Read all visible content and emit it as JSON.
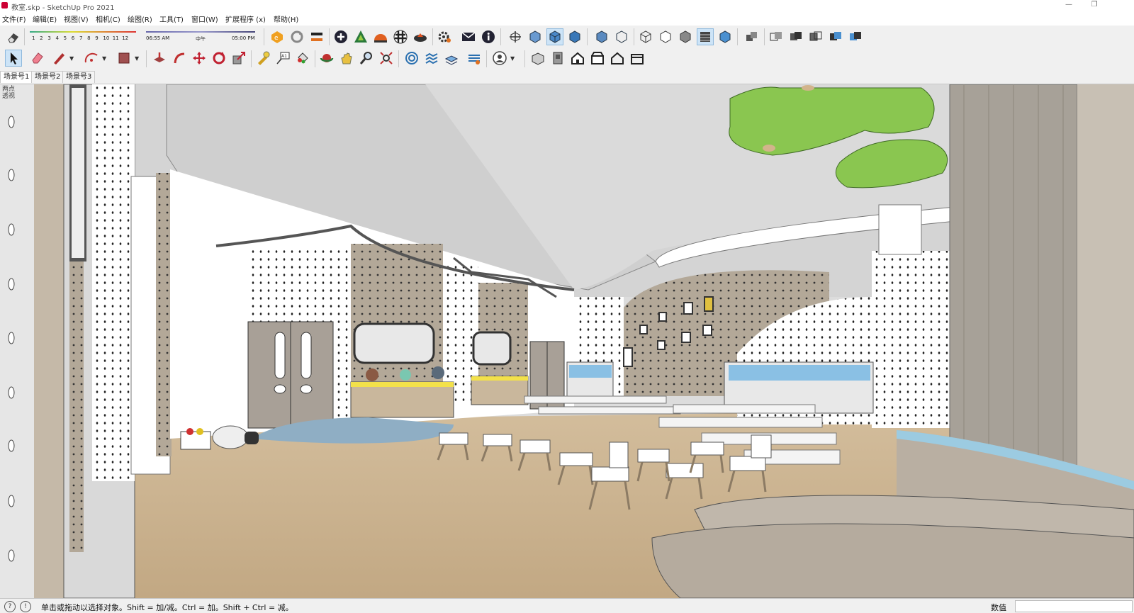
{
  "window": {
    "title": "教室.skp - SketchUp Pro 2021",
    "minimize": "—",
    "restore": "❐",
    "close": ""
  },
  "menu": [
    "文件(F)",
    "编辑(E)",
    "视图(V)",
    "相机(C)",
    "绘图(R)",
    "工具(T)",
    "窗口(W)",
    "扩展程序 (x)",
    "帮助(H)"
  ],
  "shadow": {
    "months": [
      "1",
      "2",
      "3",
      "4",
      "5",
      "6",
      "7",
      "8",
      "9",
      "10",
      "11",
      "12"
    ],
    "time_start": "06:55 AM",
    "time_mid": "中午",
    "time_end": "05:00 PM"
  },
  "scenes": {
    "tabs": [
      "场景号1",
      "场景号2",
      "场景号3"
    ],
    "active": 0
  },
  "viewport": {
    "camera_mode": "两点透视"
  },
  "status": {
    "message": "单击或拖动以选择对象。Shift = 加/减。Ctrl = 加。Shift + Ctrl = 减。",
    "measurements_label": "数值",
    "measurements_value": ""
  },
  "colors": {
    "floor": "#c9b08e",
    "wall": "#ffffff",
    "pegboard": "#b3a898",
    "ceiling": "#d4d4d4",
    "tree": "#8ac650",
    "rug": "#8faec4",
    "accent": "#f0a020",
    "toolbar_bg": "#f0f0f0"
  }
}
